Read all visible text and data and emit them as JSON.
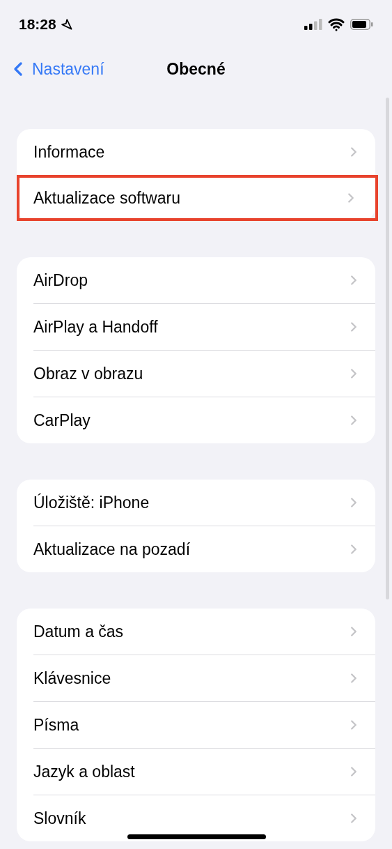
{
  "status_bar": {
    "time": "18:28"
  },
  "nav": {
    "back": "Nastavení",
    "title": "Obecné"
  },
  "groups": [
    {
      "rows": [
        {
          "label": "Informace",
          "highlighted": false
        },
        {
          "label": "Aktualizace softwaru",
          "highlighted": true
        }
      ]
    },
    {
      "rows": [
        {
          "label": "AirDrop",
          "highlighted": false
        },
        {
          "label": "AirPlay a Handoff",
          "highlighted": false
        },
        {
          "label": "Obraz v obrazu",
          "highlighted": false
        },
        {
          "label": "CarPlay",
          "highlighted": false
        }
      ]
    },
    {
      "rows": [
        {
          "label": "Úložiště: iPhone",
          "highlighted": false
        },
        {
          "label": "Aktualizace na pozadí",
          "highlighted": false
        }
      ]
    },
    {
      "rows": [
        {
          "label": "Datum a čas",
          "highlighted": false
        },
        {
          "label": "Klávesnice",
          "highlighted": false
        },
        {
          "label": "Písma",
          "highlighted": false
        },
        {
          "label": "Jazyk a oblast",
          "highlighted": false
        },
        {
          "label": "Slovník",
          "highlighted": false
        }
      ]
    }
  ]
}
